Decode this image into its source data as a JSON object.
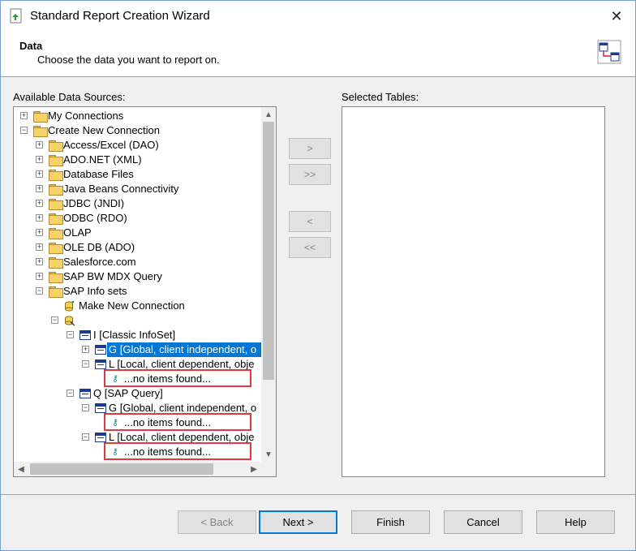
{
  "window": {
    "title": "Standard Report Creation Wizard",
    "close_glyph": "✕"
  },
  "header": {
    "title": "Data",
    "subtitle": "Choose the data you want to report on."
  },
  "labels": {
    "available": "Available Data Sources:",
    "selected": "Selected Tables:"
  },
  "tree": {
    "items": [
      {
        "label": "My Connections",
        "expander": "+"
      },
      {
        "label": "Create New Connection",
        "expander": "−"
      },
      {
        "label": "Access/Excel (DAO)",
        "expander": "+"
      },
      {
        "label": "ADO.NET (XML)",
        "expander": "+"
      },
      {
        "label": "Database Files",
        "expander": "+"
      },
      {
        "label": "Java Beans Connectivity",
        "expander": "+"
      },
      {
        "label": "JDBC (JNDI)",
        "expander": "+"
      },
      {
        "label": "ODBC (RDO)",
        "expander": "+"
      },
      {
        "label": "OLAP",
        "expander": "+"
      },
      {
        "label": "OLE DB (ADO)",
        "expander": "+"
      },
      {
        "label": "Salesforce.com",
        "expander": "+"
      },
      {
        "label": "SAP BW MDX Query",
        "expander": "+"
      },
      {
        "label": "SAP Info sets",
        "expander": "−"
      },
      {
        "label": "Make New Connection"
      },
      {
        "label": "",
        "expander": "−"
      },
      {
        "label": "I [Classic InfoSet]",
        "expander": "−"
      },
      {
        "label": "G  [Global, client independent, o",
        "expander": "+"
      },
      {
        "label": "L  [Local, client dependent, obje",
        "expander": "−"
      },
      {
        "label": "...no items found..."
      },
      {
        "label": "Q [SAP Query]",
        "expander": "−"
      },
      {
        "label": "G  [Global, client independent, o",
        "expander": "−"
      },
      {
        "label": "...no items found..."
      },
      {
        "label": "L  [Local, client dependent, obje",
        "expander": "−"
      },
      {
        "label": "...no items found..."
      }
    ]
  },
  "move_buttons": {
    "add": ">",
    "add_all": ">>",
    "remove": "<",
    "remove_all": "<<"
  },
  "footer": {
    "back": "< Back",
    "next": "Next >",
    "finish": "Finish",
    "cancel": "Cancel",
    "help": "Help"
  },
  "colors": {
    "selection": "#0078d7",
    "highlight_border": "#e0393e"
  }
}
